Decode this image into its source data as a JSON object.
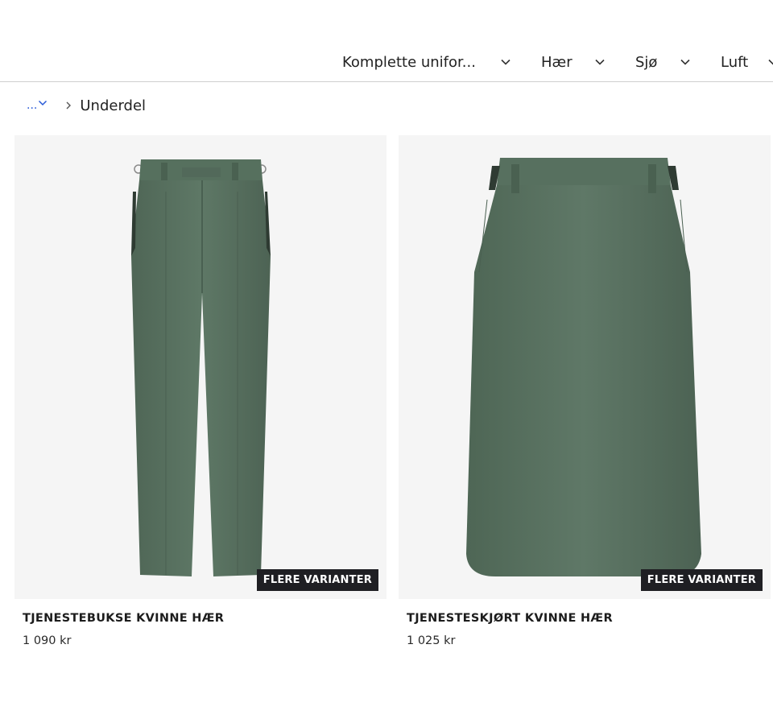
{
  "nav": {
    "items": [
      {
        "label": "Komplette unifor..."
      },
      {
        "label": "Hær"
      },
      {
        "label": "Sjø"
      },
      {
        "label": "Luft"
      }
    ]
  },
  "breadcrumb": {
    "more_label": "...",
    "current": "Underdel"
  },
  "products": [
    {
      "title": "TJENESTEBUKSE KVINNE HÆR",
      "price": "1 090 kr",
      "badge": "FLERE VARIANTER",
      "image": "green-trousers"
    },
    {
      "title": "TJENESTESKJØRT KVINNE HÆR",
      "price": "1 025 kr",
      "badge": "FLERE VARIANTER",
      "image": "green-skirt"
    }
  ],
  "colors": {
    "fabric": "#58705f",
    "image_bg": "#f5f5f5",
    "badge_bg": "#1f1f23",
    "link": "#2a5bd7"
  }
}
